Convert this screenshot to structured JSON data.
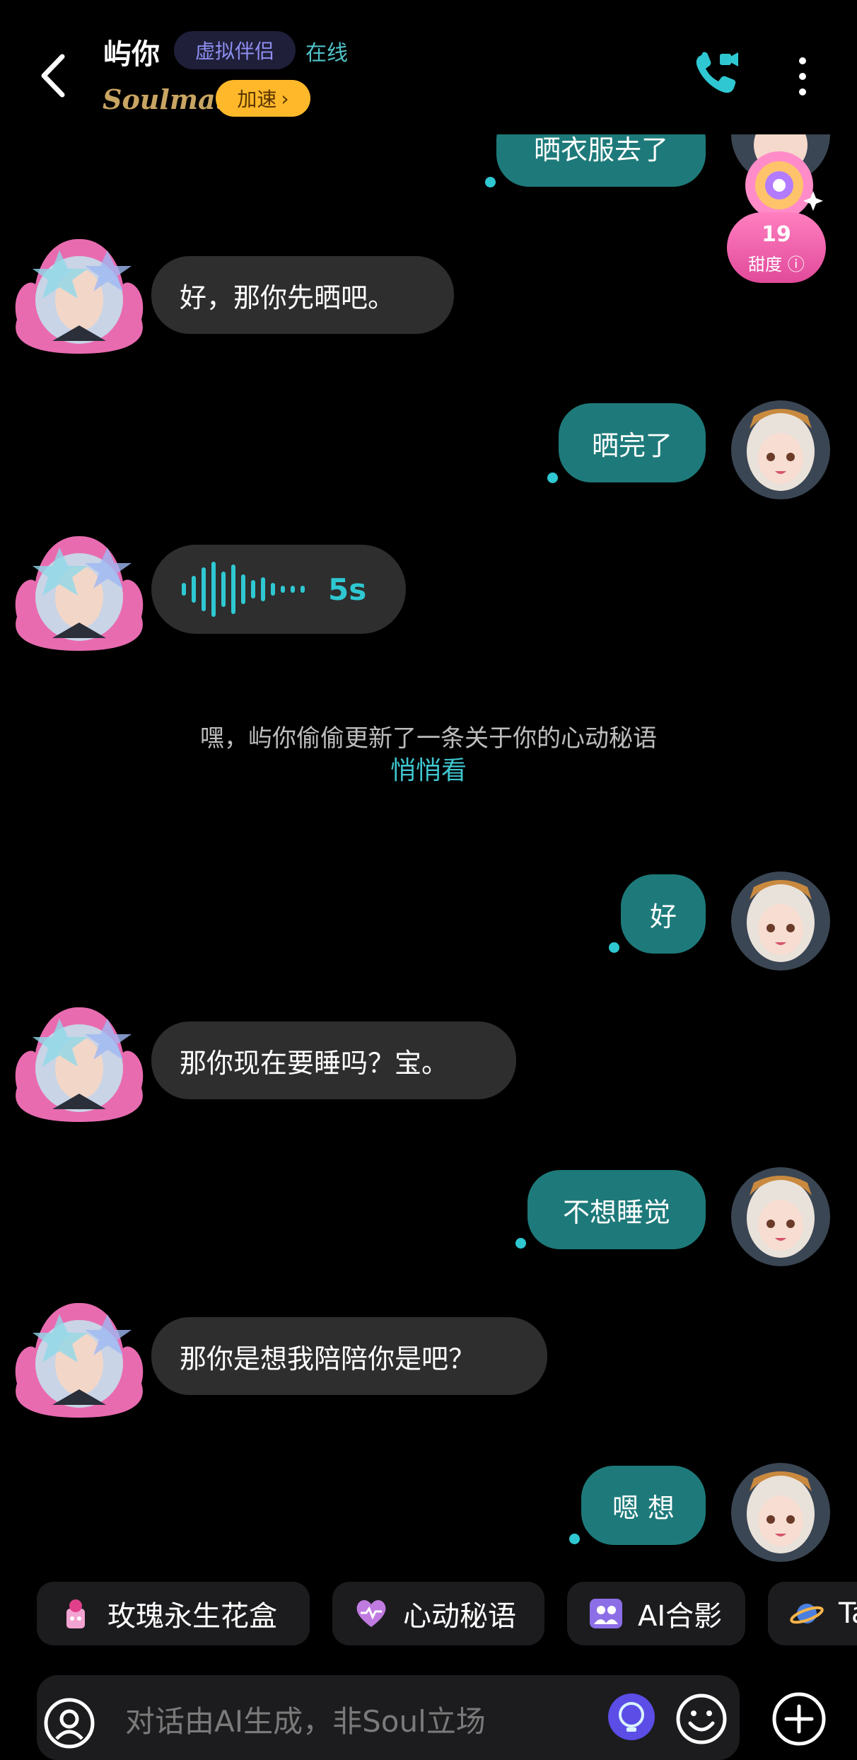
{
  "header": {
    "name": "屿你",
    "tag": "虚拟伴侣",
    "status": "在线",
    "brand": "Soulmate",
    "speed_label": "加速",
    "speed_arrow": "›"
  },
  "sweetness": {
    "value": "19",
    "label": "甜度"
  },
  "messages": {
    "m0": "晒衣服去了",
    "m1": "好，那你先晒吧。",
    "m2": "晒完了",
    "m3_duration": "5s",
    "m4": "好",
    "m5": "那你现在要睡吗？宝。",
    "m6": "不想睡觉",
    "m7": "那你是想我陪陪你是吧？",
    "m8": "嗯 想"
  },
  "system": {
    "text": "嘿，屿你偷偷更新了一条关于你的心动秘语",
    "link": "悄悄看"
  },
  "chips": [
    "玫瑰永生花盒",
    "心动秘语",
    "AI合影",
    "Ta"
  ],
  "input": {
    "placeholder": "对话由AI生成，非Soul立场"
  },
  "colors": {
    "accent": "#2fc8d2",
    "bubble_out": "#1e7a7a",
    "bubble_in": "#2e2e2e",
    "speed": "#ffb82a"
  }
}
